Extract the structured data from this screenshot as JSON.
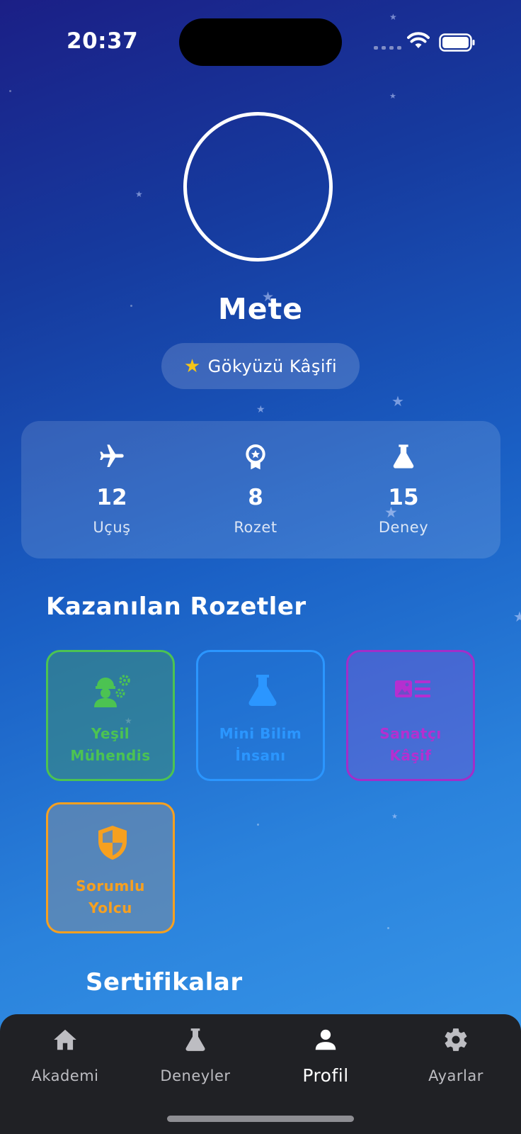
{
  "status_bar": {
    "time": "20:37"
  },
  "profile": {
    "name": "Mete",
    "rank_title": "Gökyüzü Kâşifi",
    "rank_icon": "star-icon"
  },
  "stats": [
    {
      "icon": "airplane-icon",
      "value": "12",
      "label": "Uçuş"
    },
    {
      "icon": "award-medal-icon",
      "value": "8",
      "label": "Rozet"
    },
    {
      "icon": "flask-icon",
      "value": "15",
      "label": "Deney"
    }
  ],
  "badges_section": {
    "title": "Kazanılan Rozetler",
    "badges": [
      {
        "name": "Yeşil Mühendis",
        "line1": "Yeşil",
        "line2": "Mühendis",
        "icon": "engineer-icon",
        "color": "#4cc352"
      },
      {
        "name": "Mini Bilim İnsanı",
        "line1": "Mini Bilim",
        "line2": "İnsanı",
        "icon": "flask-icon",
        "color": "#2b96ff"
      },
      {
        "name": "Sanatçı Kâşif",
        "line1": "Sanatçı",
        "line2": "Kâşif",
        "icon": "art-gallery-icon",
        "color": "#b52fd0"
      },
      {
        "name": "Sorumlu Yolcu",
        "line1": "Sorumlu",
        "line2": "Yolcu",
        "icon": "shield-icon",
        "color": "#f6a020"
      }
    ]
  },
  "certificates_section": {
    "title": "Sertifikalar"
  },
  "tab_bar": {
    "tabs": [
      {
        "label": "Akademi",
        "icon": "home-icon",
        "active": false
      },
      {
        "label": "Deneyler",
        "icon": "flask-icon",
        "active": false
      },
      {
        "label": "Profil",
        "icon": "person-icon",
        "active": true
      },
      {
        "label": "Ayarlar",
        "icon": "gear-icon",
        "active": false
      }
    ]
  },
  "colors": {
    "background_top": "#1b1f86",
    "background_bottom": "#3b9cec",
    "tab_bar": "#202125",
    "rank_star": "#f5c518"
  }
}
